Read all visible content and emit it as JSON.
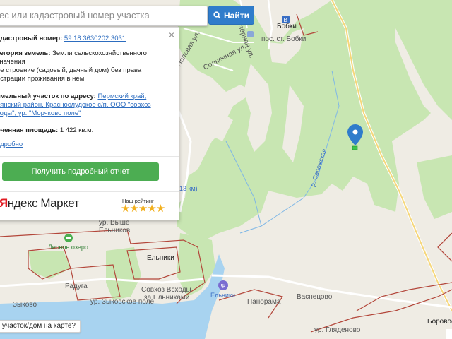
{
  "search": {
    "placeholder": "Адрес или кадастровый номер участка",
    "visible_placeholder": "ес или кадастровый номер участка",
    "button_label": "Найти"
  },
  "panel": {
    "cadastral_label": "адастровый номер:",
    "cadastral_value": "59:18:3630202:3031",
    "category_label": "тегория земель:",
    "category_value_1": "Земли сельскохозяйственного",
    "category_value_2": "значения",
    "use_text_1": "ое строение (садовый, дачный дом) без права",
    "use_text_2": "истрации проживания в нем",
    "address_label": "емельный участок по адресу:",
    "address_value_1": "Пермский край,",
    "address_value_2": "рянский район, Краснослудское с/п, ООО \"совхоз",
    "address_value_3": "ходы\", ур. \"Морчково поле\"",
    "area_label": "оченная площадь:",
    "area_value": "1 422 кв.м.",
    "more_link": "одробно",
    "report_button": "Получить подробный отчет",
    "market_logo_y": "Я",
    "market_logo_rest": "ндекс Маркет",
    "rating_label": "Наш рейтинг",
    "stars": "★★★★★",
    "rating_value": 5,
    "close": "×"
  },
  "bottom_question": "участок/дом на карте?",
  "map": {
    "labels": {
      "bobki": "Бобки",
      "pos_bobki": "пос. ст. Бобки",
      "solnechnaya": "Солнечная ул.",
      "polevaya": "Полевая ул.",
      "ozernaya": "Озёрная ул.",
      "km13": "13 км)",
      "sapozhskaya": "р. Сапожская",
      "ur_vyshe": "ур. Выше",
      "elnikov": "Ельников",
      "lesnoe": "Лесное озеро",
      "elniki": "Ельники",
      "raduga": "Радуга",
      "sovhoz_1": "Совхоз Всходы",
      "sovhoz_2": "за Ельниками",
      "zykovo": "Зыково",
      "ur_zykovskoe": "ур. Зыковское поле",
      "elniki_stop": "Ельники",
      "panorama": "Панорама",
      "vasnetsovo": "Васнецово",
      "glyadenovo": "ур. Гляденово",
      "borovaya": "Боровое"
    },
    "colors": {
      "forest": "#c8e6b2",
      "background": "#efece4",
      "water": "#a8d3f0",
      "boundary": "#b3463a",
      "pin": "#2f7ccb"
    }
  }
}
